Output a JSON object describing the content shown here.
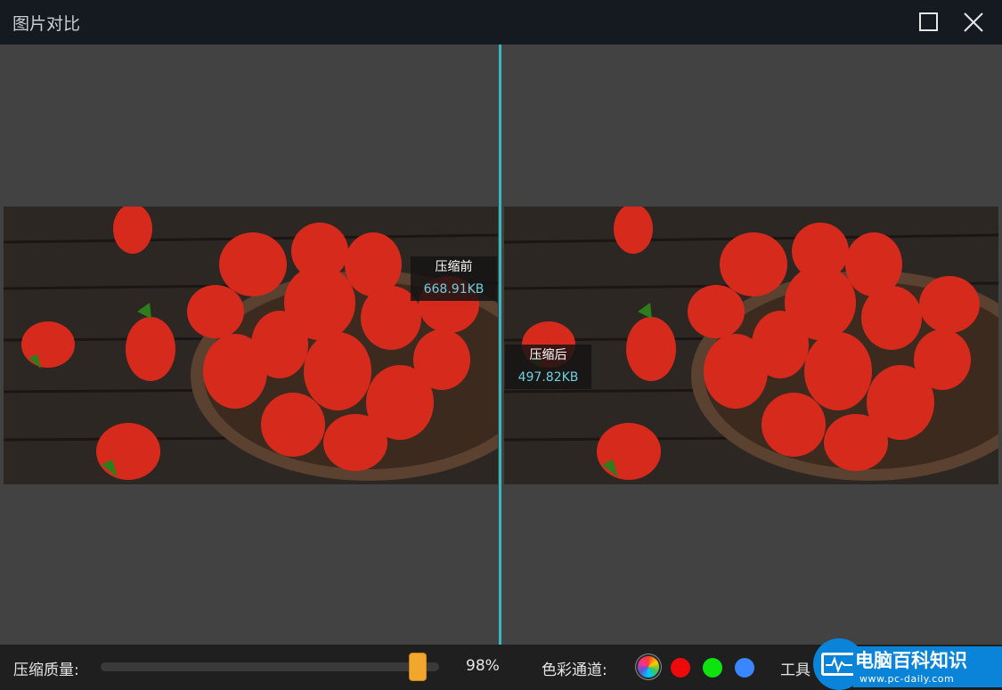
{
  "window": {
    "title": "图片对比"
  },
  "compare": {
    "before": {
      "label": "压缩前",
      "size": "668.91KB"
    },
    "after": {
      "label": "压缩后",
      "size": "497.82KB"
    }
  },
  "toolbar": {
    "quality_label": "压缩质量:",
    "quality_value": "98%",
    "quality_fraction": 0.98,
    "channel_label": "色彩通道:",
    "channels": [
      "all-channels",
      "red",
      "green",
      "blue"
    ],
    "channel_colors": {
      "red": "#ee0a0a",
      "green": "#0fe30f",
      "blue": "#3a86ff"
    },
    "tools_label": "工具"
  },
  "watermark": {
    "text": "电脑百科知识",
    "url": "www.pc-daily.com"
  },
  "colors": {
    "accent_divider": "#38b7bd",
    "slider_thumb": "#f1a62c",
    "titlebar": "#151a21"
  }
}
